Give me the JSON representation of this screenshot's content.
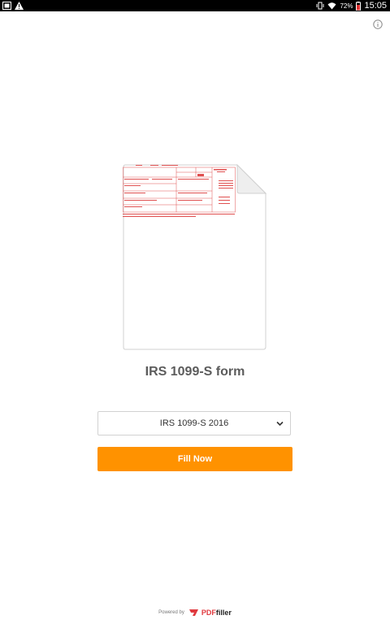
{
  "status_bar": {
    "battery_percent": "72%",
    "time": "15:05"
  },
  "main": {
    "form_title": "IRS 1099-S form",
    "select": {
      "value": "IRS 1099-S 2016"
    },
    "fill_button_label": "Fill Now"
  },
  "footer": {
    "powered_by": "Powered by",
    "brand_prefix": "PDF",
    "brand_suffix": "filler"
  },
  "colors": {
    "accent": "#ff9200",
    "form_red": "#e05050",
    "brand_red": "#e0393e"
  }
}
